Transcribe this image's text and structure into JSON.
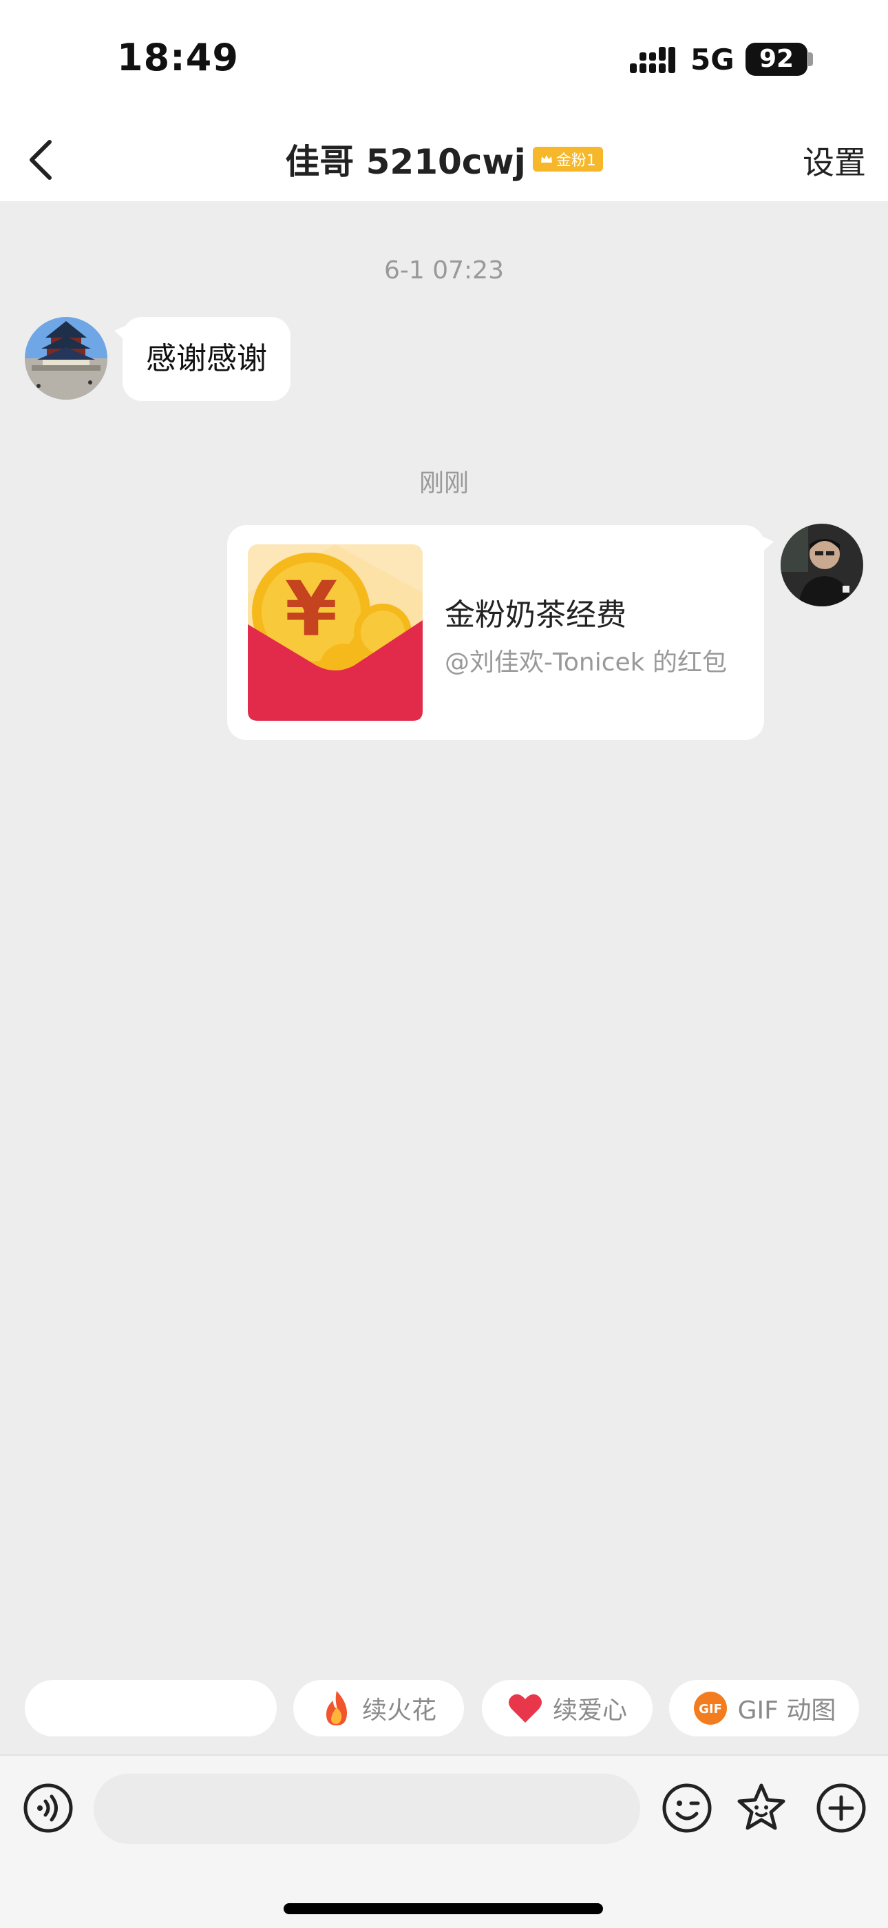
{
  "status_bar": {
    "time": "18:49",
    "network": "5G",
    "battery": "92"
  },
  "header": {
    "title": "佳哥 5210cwj",
    "fan_badge": "金粉1",
    "settings_label": "设置",
    "back_icon": "chevron-left-icon"
  },
  "chat": {
    "messages": [
      {
        "timestamp": "6-1 07:23",
        "sender": "contact",
        "text": "感谢感谢"
      },
      {
        "timestamp": "刚刚",
        "sender": "self",
        "type": "red-packet",
        "title": "金粉奶茶经费",
        "subtitle": "@刘佳欢-Tonicek 的红包"
      }
    ]
  },
  "quick_actions": {
    "blank": "",
    "spark_label": "续火花",
    "heart_label": "续爱心",
    "gif_label": "GIF 动图",
    "gif_icon_text": "GIF"
  },
  "composer": {
    "input_value": "",
    "input_placeholder": "",
    "icons": [
      "voice-icon",
      "emoji-icon",
      "sticker-icon",
      "plus-icon"
    ]
  },
  "colors": {
    "red_packet": "#e22b4a",
    "coin": "#f5b91c",
    "badge": "#f6b72a",
    "background": "#ededed"
  }
}
